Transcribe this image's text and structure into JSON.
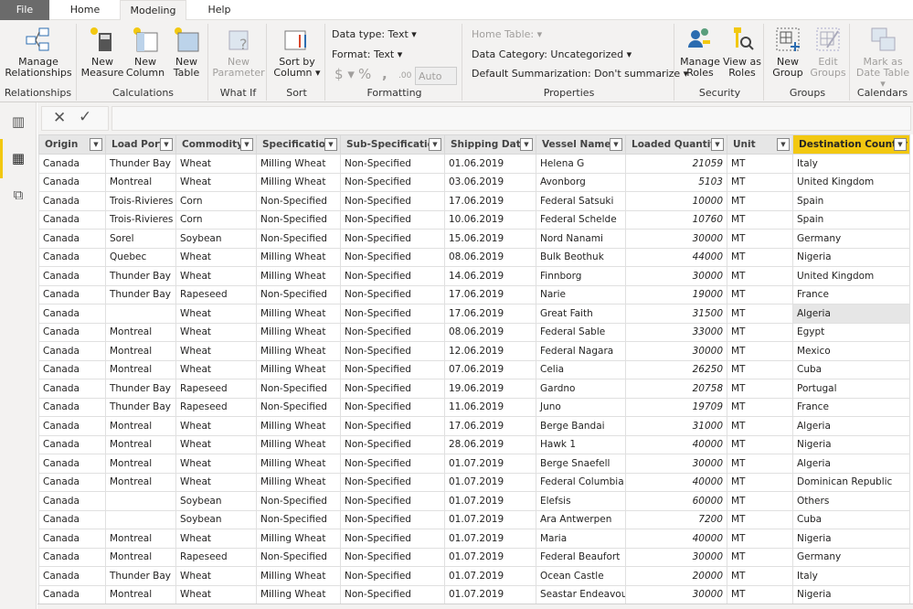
{
  "tabs": [
    "File",
    "Home",
    "Modeling",
    "Help"
  ],
  "ribbon": {
    "relationships": {
      "button": "Manage Relationships",
      "label": "Relationships"
    },
    "calculations": {
      "new_measure": "New Measure",
      "new_column": "New Column",
      "new_table": "New Table",
      "label": "Calculations"
    },
    "whatif": {
      "new_parameter": "New Parameter",
      "label": "What If"
    },
    "sort": {
      "sort_by_column": "Sort by Column",
      "label": "Sort"
    },
    "formatting": {
      "data_type": "Data type: Text",
      "format": "Format: Text",
      "currency": "$",
      "percent": "%",
      "comma": ",",
      "decimals": ".00",
      "auto": "Auto",
      "label": "Formatting"
    },
    "properties": {
      "home_table": "Home Table:",
      "data_category": "Data Category: Uncategorized",
      "default_summarization": "Default Summarization: Don't summarize",
      "label": "Properties"
    },
    "security": {
      "manage_roles": "Manage Roles",
      "view_as_roles": "View as Roles",
      "label": "Security"
    },
    "groups": {
      "new_group": "New Group",
      "edit_groups": "Edit Groups",
      "label": "Groups"
    },
    "calendars": {
      "mark_as_date_table": "Mark as Date Table",
      "label": "Calendars"
    }
  },
  "colors": {
    "accent": "#f2c811",
    "file_tab": "#6b6b6b"
  },
  "table": {
    "columns": [
      "Origin",
      "Load Port",
      "Commodity",
      "Specification",
      "Sub-Specification",
      "Shipping Date",
      "Vessel Name",
      "Loaded Quantity",
      "Unit",
      "Destination Country"
    ],
    "selected_column": "Destination Country",
    "rows": [
      [
        "Canada",
        "Thunder Bay",
        "Wheat",
        "Milling Wheat",
        "Non-Specified",
        "01.06.2019",
        "Helena G",
        "21059",
        "MT",
        "Italy"
      ],
      [
        "Canada",
        "Montreal",
        "Wheat",
        "Milling Wheat",
        "Non-Specified",
        "03.06.2019",
        "Avonborg",
        "5103",
        "MT",
        "United Kingdom"
      ],
      [
        "Canada",
        "Trois-Rivieres",
        "Corn",
        "Non-Specified",
        "Non-Specified",
        "17.06.2019",
        "Federal Satsuki",
        "10000",
        "MT",
        "Spain"
      ],
      [
        "Canada",
        "Trois-Rivieres",
        "Corn",
        "Non-Specified",
        "Non-Specified",
        "10.06.2019",
        "Federal Schelde",
        "10760",
        "MT",
        "Spain"
      ],
      [
        "Canada",
        "Sorel",
        "Soybean",
        "Non-Specified",
        "Non-Specified",
        "15.06.2019",
        "Nord Nanami",
        "30000",
        "MT",
        "Germany"
      ],
      [
        "Canada",
        "Quebec",
        "Wheat",
        "Milling Wheat",
        "Non-Specified",
        "08.06.2019",
        "Bulk Beothuk",
        "44000",
        "MT",
        "Nigeria"
      ],
      [
        "Canada",
        "Thunder Bay",
        "Wheat",
        "Milling Wheat",
        "Non-Specified",
        "14.06.2019",
        "Finnborg",
        "30000",
        "MT",
        "United Kingdom"
      ],
      [
        "Canada",
        "Thunder Bay",
        "Rapeseed",
        "Non-Specified",
        "Non-Specified",
        "17.06.2019",
        "Narie",
        "19000",
        "MT",
        "France"
      ],
      [
        "Canada",
        "",
        "Wheat",
        "Milling Wheat",
        "Non-Specified",
        "17.06.2019",
        "Great Faith",
        "31500",
        "MT",
        "Algeria"
      ],
      [
        "Canada",
        "Montreal",
        "Wheat",
        "Milling Wheat",
        "Non-Specified",
        "08.06.2019",
        "Federal Sable",
        "33000",
        "MT",
        "Egypt"
      ],
      [
        "Canada",
        "Montreal",
        "Wheat",
        "Milling Wheat",
        "Non-Specified",
        "12.06.2019",
        "Federal Nagara",
        "30000",
        "MT",
        "Mexico"
      ],
      [
        "Canada",
        "Montreal",
        "Wheat",
        "Milling Wheat",
        "Non-Specified",
        "07.06.2019",
        "Celia",
        "26250",
        "MT",
        "Cuba"
      ],
      [
        "Canada",
        "Thunder Bay",
        "Rapeseed",
        "Non-Specified",
        "Non-Specified",
        "19.06.2019",
        "Gardno",
        "20758",
        "MT",
        "Portugal"
      ],
      [
        "Canada",
        "Thunder Bay",
        "Rapeseed",
        "Non-Specified",
        "Non-Specified",
        "11.06.2019",
        "Juno",
        "19709",
        "MT",
        "France"
      ],
      [
        "Canada",
        "Montreal",
        "Wheat",
        "Milling Wheat",
        "Non-Specified",
        "17.06.2019",
        "Berge Bandai",
        "31000",
        "MT",
        "Algeria"
      ],
      [
        "Canada",
        "Montreal",
        "Wheat",
        "Milling Wheat",
        "Non-Specified",
        "28.06.2019",
        "Hawk  1",
        "40000",
        "MT",
        "Nigeria"
      ],
      [
        "Canada",
        "Montreal",
        "Wheat",
        "Milling Wheat",
        "Non-Specified",
        "01.07.2019",
        "Berge Snaefell",
        "30000",
        "MT",
        "Algeria"
      ],
      [
        "Canada",
        "Montreal",
        "Wheat",
        "Milling Wheat",
        "Non-Specified",
        "01.07.2019",
        "Federal Columbia",
        "40000",
        "MT",
        "Dominican Republic"
      ],
      [
        "Canada",
        "",
        "Soybean",
        "Non-Specified",
        "Non-Specified",
        "01.07.2019",
        "Elefsis",
        "60000",
        "MT",
        "Others"
      ],
      [
        "Canada",
        "",
        "Soybean",
        "Non-Specified",
        "Non-Specified",
        "01.07.2019",
        "Ara Antwerpen",
        "7200",
        "MT",
        "Cuba"
      ],
      [
        "Canada",
        "Montreal",
        "Wheat",
        "Milling Wheat",
        "Non-Specified",
        "01.07.2019",
        "Maria",
        "40000",
        "MT",
        "Nigeria"
      ],
      [
        "Canada",
        "Montreal",
        "Rapeseed",
        "Non-Specified",
        "Non-Specified",
        "01.07.2019",
        "Federal Beaufort",
        "30000",
        "MT",
        "Germany"
      ],
      [
        "Canada",
        "Thunder Bay",
        "Wheat",
        "Milling Wheat",
        "Non-Specified",
        "01.07.2019",
        "Ocean Castle",
        "20000",
        "MT",
        "Italy"
      ],
      [
        "Canada",
        "Montreal",
        "Wheat",
        "Milling Wheat",
        "Non-Specified",
        "01.07.2019",
        "Seastar Endeavour",
        "30000",
        "MT",
        "Nigeria"
      ]
    ]
  }
}
